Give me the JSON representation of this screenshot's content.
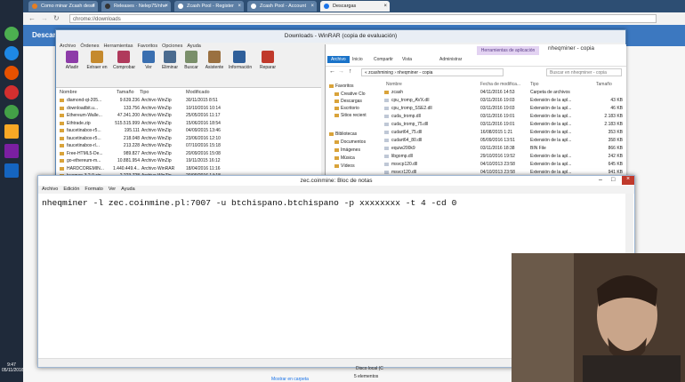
{
  "chrome": {
    "tabs": [
      "Como minar Zcash desd",
      "Releases · Nelep75/nhe",
      "Zcash Pool - Register",
      "Zcash Pool - Account",
      "Descargas"
    ],
    "url": "chrome://downloads",
    "page_title": "Descar"
  },
  "winrar": {
    "title": "Downloads - WinRAR (copia de evaluación)",
    "menu": [
      "Archivo",
      "Órdenes",
      "Herramientas",
      "Favoritos",
      "Opciones",
      "Ayuda"
    ],
    "toolbar": [
      "Añadir",
      "Extraer en",
      "Comprobar",
      "Ver",
      "Eliminar",
      "Buscar",
      "Asistente",
      "Información",
      "Reparar"
    ],
    "columns": [
      "Nombre",
      "Tamaño",
      "Tipo",
      "Modificado"
    ],
    "rows": [
      {
        "name": "diamond-qt-205...",
        "size": "9.639.236",
        "type": "Archivo WinZip",
        "mod": "30/11/2015 8:51"
      },
      {
        "name": "downloadbit.u...",
        "size": "133.756",
        "type": "Archivo WinZip",
        "mod": "10/10/2016 10:14"
      },
      {
        "name": "Ethereum-Walle...",
        "size": "47.341.200",
        "type": "Archivo WinZip",
        "mod": "25/05/2016 11:17"
      },
      {
        "name": "Ethtrade.zip",
        "size": "515.515.999",
        "type": "Archivo WinZip",
        "mod": "15/06/2016 18:54"
      },
      {
        "name": "faucetinabox-r5...",
        "size": "195.111",
        "type": "Archivo WinZip",
        "mod": "04/09/2015 13:46"
      },
      {
        "name": "faucetinabox-r5...",
        "size": "218.048",
        "type": "Archivo WinZip",
        "mod": "23/06/2016 12:10"
      },
      {
        "name": "faucetinabox-rl...",
        "size": "213.228",
        "type": "Archivo WinZip",
        "mod": "07/10/2016 15:18"
      },
      {
        "name": "Free-HTML5-De...",
        "size": "989.827",
        "type": "Archivo WinZip",
        "mod": "20/09/2016 15:08"
      },
      {
        "name": "go-ethereum-m...",
        "size": "10.881.954",
        "type": "Archivo WinZip",
        "mod": "19/11/2015 16:12"
      },
      {
        "name": "HARDCOREMIN...",
        "size": "1.440.449.4...",
        "type": "Archivo WinRAR",
        "mod": "18/04/2016 11:16"
      },
      {
        "name": "hueman-3.2.0.zip",
        "size": "2.223.728",
        "type": "Archivo WinZip",
        "mod": "20/09/2016 14:18"
      }
    ]
  },
  "explorer": {
    "title": "nheqminer - copia",
    "tools_tab": "Herramientas de aplicación",
    "ribbon": [
      "Archivo",
      "Inicio",
      "Compartir",
      "Vista",
      "Administrar"
    ],
    "path": "« zcashmining › nheqminer - copia",
    "search_placeholder": "Buscar en nheqminer - copia",
    "sidebar": [
      "Favoritos",
      "Creative Clo",
      "Descargas",
      "Escritorio",
      "Sitios recient",
      "Bibliotecas",
      "Documentos",
      "Imágenes",
      "Música",
      "Vídeos"
    ],
    "columns": [
      "Nombre",
      "Fecha de modifica...",
      "Tipo",
      "Tamaño"
    ],
    "files": [
      {
        "name": "zcash",
        "date": "04/11/2016 14:53",
        "type": "Carpeta de archivos",
        "size": "",
        "kind": "folder"
      },
      {
        "name": "cpu_tromp_AVX.dll",
        "date": "03/11/2016 19:03",
        "type": "Extensión de la apl...",
        "size": "43 KB",
        "kind": "dll"
      },
      {
        "name": "cpu_tromp_SSE2.dll",
        "date": "03/11/2016 19:03",
        "type": "Extensión de la apl...",
        "size": "46 KB",
        "kind": "dll"
      },
      {
        "name": "cuda_tromp.dll",
        "date": "03/11/2016 19:01",
        "type": "Extensión de la apl...",
        "size": "2.183 KB",
        "kind": "dll"
      },
      {
        "name": "cuda_tromp_75.dll",
        "date": "03/11/2016 19:01",
        "type": "Extensión de la apl...",
        "size": "2.183 KB",
        "kind": "dll"
      },
      {
        "name": "cudart64_75.dll",
        "date": "16/08/2015 1:21",
        "type": "Extensión de la apl...",
        "size": "353 KB",
        "kind": "dll"
      },
      {
        "name": "cudart64_80.dll",
        "date": "05/09/2016 13:51",
        "type": "Extensión de la apl...",
        "size": "358 KB",
        "kind": "dll"
      },
      {
        "name": "equiw200k9",
        "date": "03/11/2016 18:38",
        "type": "BIN File",
        "size": "866 KB",
        "kind": "dll"
      },
      {
        "name": "libgomp.dll",
        "date": "29/10/2016 19:52",
        "type": "Extensión de la apl...",
        "size": "242 KB",
        "kind": "dll"
      },
      {
        "name": "msvcp120.dll",
        "date": "04/10/2013 23:58",
        "type": "Extensión de la apl...",
        "size": "645 KB",
        "kind": "dll"
      },
      {
        "name": "msvcr120.dll",
        "date": "04/10/2013 23:58",
        "type": "Extensión de la apl...",
        "size": "941 KB",
        "kind": "dll"
      }
    ]
  },
  "notepad": {
    "title": "zec.coinmine: Bloc de notas",
    "menu": [
      "Archivo",
      "Edición",
      "Formato",
      "Ver",
      "Ayuda"
    ],
    "content": "nheqminer -l zec.coinmine.pl:7007 -u btchispano.btchispano -p xxxxxxxx -t 4 -cd 0"
  },
  "footer": {
    "disk": "Disco local (C",
    "elements": "5 elementos",
    "link": "Mostrar en carpeta"
  },
  "taskbar": {
    "time": "9:47",
    "date": "05/11/2016"
  }
}
